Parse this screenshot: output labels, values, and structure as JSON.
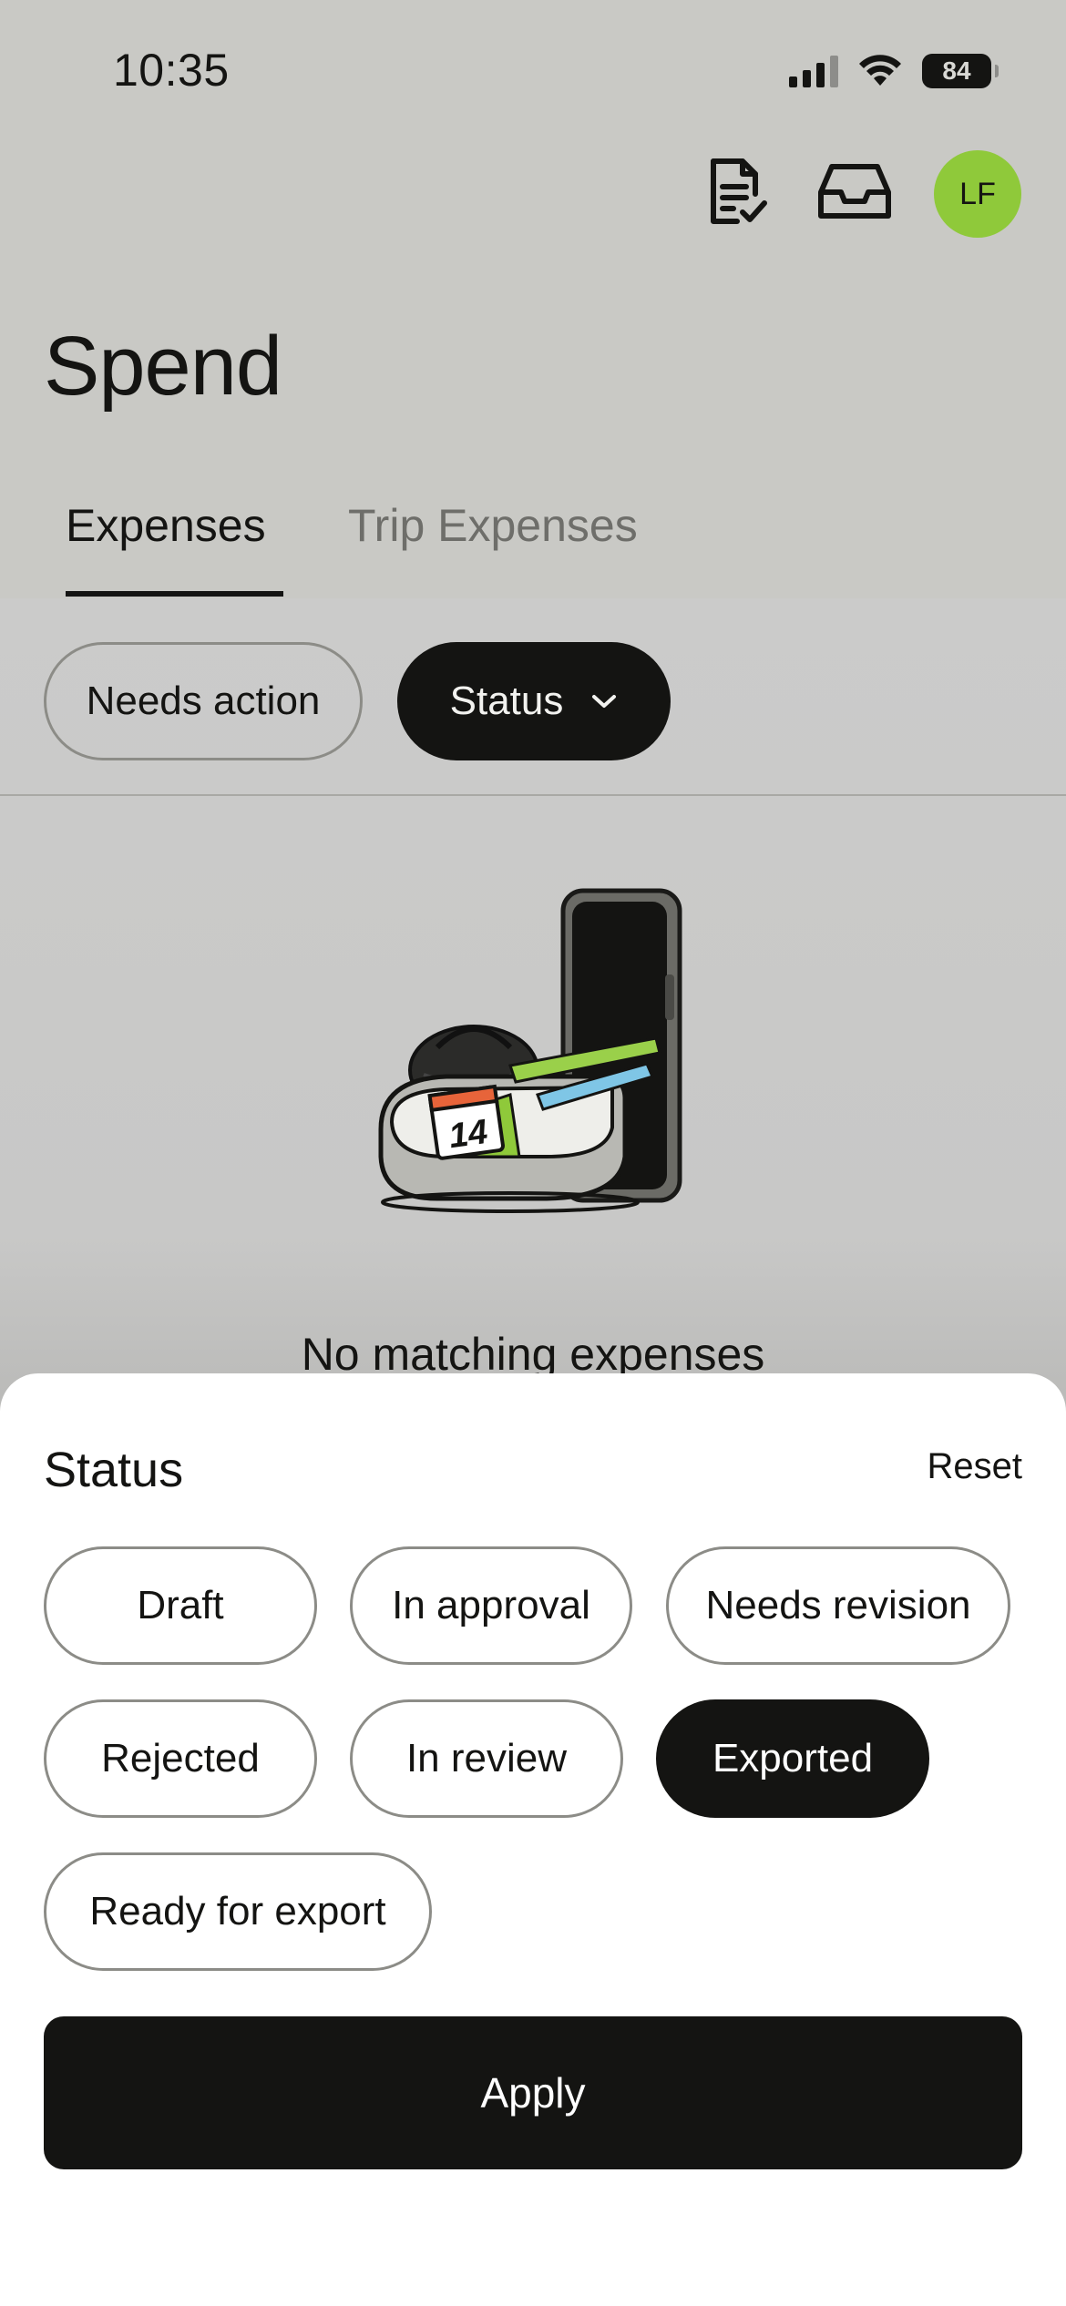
{
  "status_bar": {
    "time": "10:35",
    "battery": "84",
    "icons": [
      "signal-icon",
      "wifi-icon",
      "battery-icon"
    ]
  },
  "header": {
    "icons": [
      "receipt-check-icon",
      "inbox-icon"
    ],
    "avatar_initials": "LF",
    "avatar_color": "#8fc93a"
  },
  "page": {
    "title": "Spend",
    "tabs": [
      {
        "label": "Expenses",
        "active": true
      },
      {
        "label": "Trip Expenses",
        "active": false
      }
    ]
  },
  "filters": {
    "needs_action": "Needs action",
    "status": "Status"
  },
  "empty_state": {
    "message": "No matching expenses",
    "calendar_day": "14"
  },
  "sheet": {
    "title": "Status",
    "reset": "Reset",
    "options": [
      {
        "label": "Draft",
        "selected": false
      },
      {
        "label": "In approval",
        "selected": false
      },
      {
        "label": "Needs revision",
        "selected": false
      },
      {
        "label": "Rejected",
        "selected": false
      },
      {
        "label": "In review",
        "selected": false
      },
      {
        "label": "Exported",
        "selected": true
      },
      {
        "label": "Ready for export",
        "selected": false
      }
    ],
    "apply": "Apply"
  },
  "colors": {
    "ink": "#141412",
    "accent_green": "#8fc93a",
    "scrim": "#c9c9c5"
  }
}
